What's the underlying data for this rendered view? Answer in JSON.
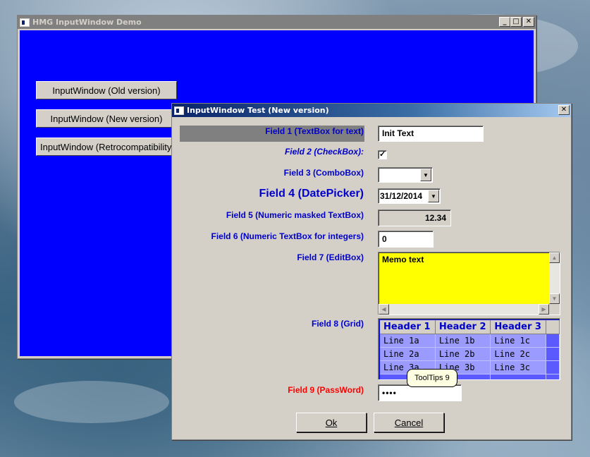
{
  "main_window": {
    "title": "HMG InputWindow Demo",
    "buttons": [
      "InputWindow (Old version)",
      "InputWindow (New version)",
      "InputWindow (Retrocompatibility)"
    ],
    "client_color": "#0000ff"
  },
  "dialog": {
    "title": "InputWindow Test (New version)",
    "fields": {
      "f1": {
        "label": "Field 1 (TextBox for text)",
        "value": "Init Text"
      },
      "f2": {
        "label": "Field 2 (CheckBox):",
        "checked": true,
        "check_glyph": "✓"
      },
      "f3": {
        "label": "Field 3 (ComboBox)",
        "value": ""
      },
      "f4": {
        "label": "Field 4 (DatePicker)",
        "value": "31/12/2014"
      },
      "f5": {
        "label": "Field 5 (Numeric masked TextBox)",
        "value": "12.34"
      },
      "f6": {
        "label": "Field 6 (Numeric TextBox for integers)",
        "value": "0"
      },
      "f7": {
        "label": "Field 7 (EditBox)",
        "value": "Memo text",
        "bg": "#ffff00"
      },
      "f8": {
        "label": "Field 8 (Grid)",
        "headers": [
          "Header 1",
          "Header 2",
          "Header 3"
        ],
        "rows": [
          [
            "Line 1a",
            "Line 1b",
            "Line 1c"
          ],
          [
            "Line 2a",
            "Line 2b",
            "Line 2c"
          ],
          [
            "Line 3a",
            "Line 3b",
            "Line 3c"
          ]
        ]
      },
      "f9": {
        "label": "Field 9 (PassWord)",
        "value": "••••",
        "label_color": "#ff0000"
      }
    },
    "tooltip": "ToolTips 9",
    "ok_label": "Ok",
    "cancel_label": "Cancel"
  },
  "caption_buttons": {
    "minimize": "_",
    "maximize": "□",
    "close": "✕",
    "dropdown": "▼",
    "scroll_up": "▲",
    "scroll_down": "▼",
    "scroll_left": "◀",
    "scroll_right": "▶"
  }
}
